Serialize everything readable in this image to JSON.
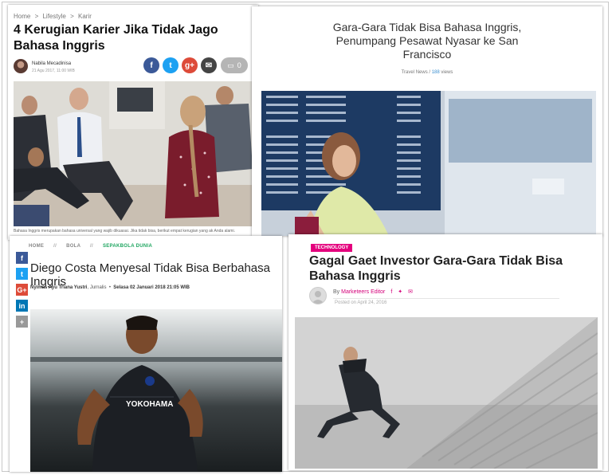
{
  "card1": {
    "breadcrumb": [
      "Home",
      ">",
      "Lifestyle",
      ">",
      "Karir"
    ],
    "title": "4 Kerugian Karier Jika Tidak Jago Bahasa Inggris",
    "author": "Nabila Mecadinisa",
    "date": "21 Agu 2017, 11:00 WIB",
    "share": [
      {
        "icon": "facebook-icon",
        "glyph": "f",
        "color": "#3b5998"
      },
      {
        "icon": "twitter-icon",
        "glyph": "t",
        "color": "#1da1f2"
      },
      {
        "icon": "google-plus-icon",
        "glyph": "g+",
        "color": "#dd4b39"
      },
      {
        "icon": "email-icon",
        "glyph": "✉",
        "color": "#444444"
      }
    ],
    "comment_count": "0",
    "caption": "Bahasa Inggris merupakan bahasa universal yang wajib dikuasai. Jika tidak bisa, berikut empat kerugian yang ak Anda alami."
  },
  "card2": {
    "title": "Gara-Gara Tidak Bisa Bahasa Inggris, Penumpang Pesawat Nyasar ke San Francisco",
    "category": "Travel News",
    "separator": "/",
    "views_count": "188",
    "views_label": "views"
  },
  "card3": {
    "nav": {
      "home": "HOME",
      "sep": "//",
      "bola": "BOLA",
      "section": "SEPAKBOLA DUNIA"
    },
    "title": "Diego Costa Menyesal Tidak Bisa Berbahasa Inggris",
    "author": "Nyimas Ayu Triana Yustri",
    "role": ", Jurnalis",
    "date": "Selasa 02 Januari 2018 21:05 WIB",
    "share": [
      {
        "icon": "facebook-icon",
        "glyph": "f",
        "color": "#3b5998"
      },
      {
        "icon": "twitter-icon",
        "glyph": "t",
        "color": "#1da1f2"
      },
      {
        "icon": "google-plus-icon",
        "glyph": "G+",
        "color": "#dd4b39"
      },
      {
        "icon": "linkedin-icon",
        "glyph": "in",
        "color": "#0077b5"
      },
      {
        "icon": "more-icon",
        "glyph": "+",
        "color": "#999999"
      }
    ],
    "jersey_text": "YOKOHAMA"
  },
  "card4": {
    "badge": "TECHNOLOGY",
    "title": "Gagal Gaet Investor Gara-Gara Tidak Bisa Bahasa Inggris",
    "by": "By",
    "author": "Marketeers Editor",
    "date": "Posted on April 24, 2016"
  }
}
